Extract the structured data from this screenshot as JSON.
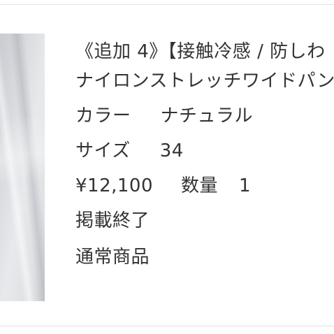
{
  "product": {
    "title_line1": "《追加 4》【接触冷感 / 防しわ",
    "title_line2": "ナイロンストレッチワイドパンツ",
    "color_label": "カラー",
    "color_value": "ナチュラル",
    "size_label": "サイズ",
    "size_value": "34",
    "price": "¥12,100",
    "quantity_label": "数量",
    "quantity_value": "1",
    "listing_status": "掲載終了",
    "product_type": "通常商品"
  },
  "image": {
    "description_icon": "product-thumbnail"
  }
}
